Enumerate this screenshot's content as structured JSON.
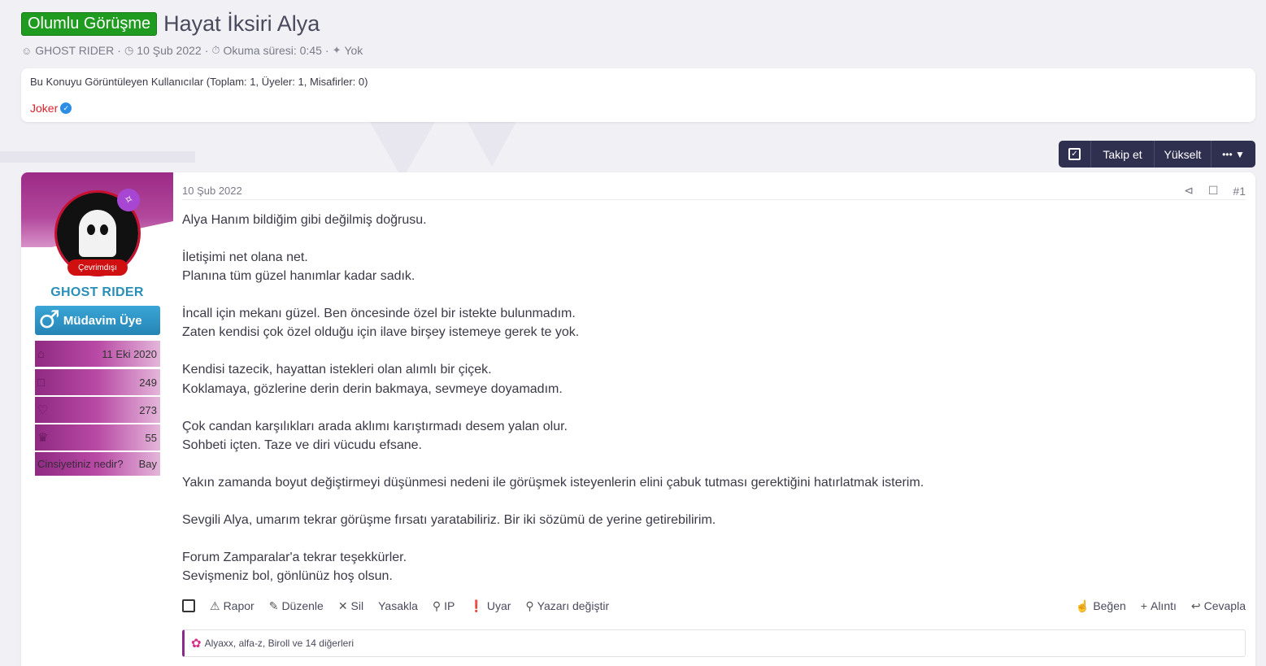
{
  "thread": {
    "prefix": "Olumlu Görüşme",
    "title": "Hayat İksiri Alya",
    "author": "GHOST RIDER",
    "date": "10 Şub 2022",
    "reading_time": "Okuma süresi: 0:45",
    "tags": "Yok",
    "prefix_color": "#1f9b1f"
  },
  "viewers": {
    "title": "Bu Konuyu Görüntüleyen Kullanıcılar (Toplam: 1, Üyeler: 1, Misafirler: 0)",
    "user": "Joker",
    "user_color": "#e0202b"
  },
  "toolbar": {
    "follow": "Takip et",
    "boost": "Yükselt",
    "more": "•••"
  },
  "post": {
    "date": "10 Şub 2022",
    "number": "#1",
    "user": {
      "status": "Çevrimdışı",
      "name": "GHOST RIDER",
      "title": "Müdavim Üye",
      "joined": "11 Eki 2020",
      "messages": "249",
      "reactions": "273",
      "points": "55",
      "gender_label": "Cinsiyetiniz nedir?",
      "gender_value": "Bay"
    },
    "paragraphs": [
      "Alya Hanım bildiğim gibi değilmiş doğrusu.",
      "İletişimi net olana net.\nPlanına tüm güzel hanımlar kadar sadık.",
      "İncall için mekanı güzel. Ben öncesinde özel bir istekte bulunmadım.\nZaten kendisi çok özel olduğu için ilave birşey istemeye gerek te yok.",
      "Kendisi tazecik, hayattan istekleri olan alımlı bir çiçek.\nKoklamaya, gözlerine derin derin bakmaya, sevmeye doyamadım.",
      "Çok candan karşılıkları arada aklımı karıştırmadı desem yalan olur.\nSohbeti içten. Taze ve diri vücudu efsane.",
      "Yakın zamanda boyut değiştirmeyi düşünmesi nedeni ile görüşmek isteyenlerin elini çabuk tutması gerektiğini hatırlatmak isterim.",
      "Sevgili Alya, umarım tekrar görüşme fırsatı yaratabiliriz. Bir iki sözümü de yerine getirebilirim.",
      "Forum Zamparalar'a tekrar teşekkürler.\nSevişmeniz bol, gönlünüz hoş olsun."
    ],
    "actions_left": {
      "report": "Rapor",
      "edit": "Düzenle",
      "delete": "Sil",
      "ban": "Yasakla",
      "ip": "IP",
      "warn": "Uyar",
      "change_author": "Yazarı değiştir"
    },
    "actions_right": {
      "like": "Beğen",
      "quote": "Alıntı",
      "reply": "Cevapla"
    },
    "reactions_text": "Alyaxx, alfa-z, Biroll ve 14 diğerleri"
  },
  "icons": {
    "author": "user-icon",
    "date": "clock-icon",
    "reading": "timer-icon",
    "tags": "tag-icon"
  }
}
